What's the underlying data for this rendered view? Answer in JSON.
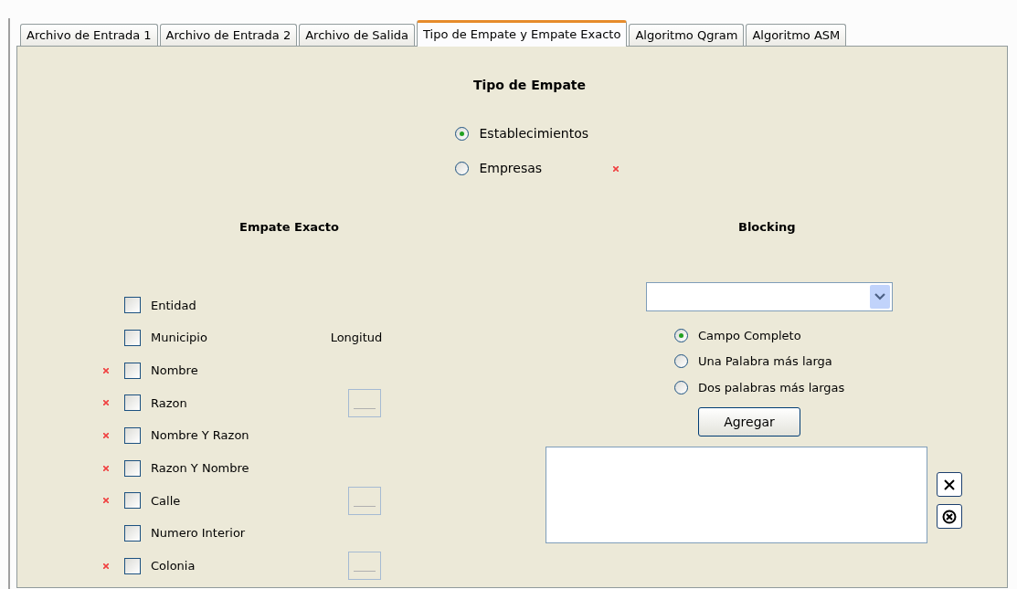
{
  "tabs": [
    {
      "label": "Archivo de Entrada 1",
      "selected": false
    },
    {
      "label": "Archivo de Entrada 2",
      "selected": false
    },
    {
      "label": "Archivo de Salida",
      "selected": false
    },
    {
      "label": "Tipo de Empate y Empate Exacto",
      "selected": true
    },
    {
      "label": "Algoritmo Qgram",
      "selected": false
    },
    {
      "label": "Algoritmo ASM",
      "selected": false
    }
  ],
  "tipo_empate": {
    "title": "Tipo de Empate",
    "options": [
      {
        "label": "Establecimientos",
        "selected": true,
        "error_marker": false
      },
      {
        "label": "Empresas",
        "selected": false,
        "error_marker": true
      }
    ]
  },
  "empate_exacto": {
    "title": "Empate Exacto",
    "length_heading": "Longitud",
    "fields": [
      {
        "label": "Entidad",
        "checked": false,
        "error_marker": false,
        "length_field": false
      },
      {
        "label": "Municipio",
        "checked": false,
        "error_marker": false,
        "length_field": false
      },
      {
        "label": "Nombre",
        "checked": false,
        "error_marker": true,
        "length_field": false
      },
      {
        "label": "Razon",
        "checked": false,
        "error_marker": true,
        "length_field": true
      },
      {
        "label": "Nombre Y Razon",
        "checked": false,
        "error_marker": true,
        "length_field": false
      },
      {
        "label": "Razon Y Nombre",
        "checked": false,
        "error_marker": true,
        "length_field": false
      },
      {
        "label": "Calle",
        "checked": false,
        "error_marker": true,
        "length_field": true
      },
      {
        "label": "Numero Interior",
        "checked": false,
        "error_marker": false,
        "length_field": false
      },
      {
        "label": "Colonia",
        "checked": false,
        "error_marker": true,
        "length_field": true
      }
    ]
  },
  "blocking": {
    "title": "Blocking",
    "options": [
      {
        "label": "Campo Completo",
        "selected": true
      },
      {
        "label": "Una Palabra más larga",
        "selected": false
      },
      {
        "label": "Dos palabras más largas",
        "selected": false
      }
    ],
    "add_button": "Agregar"
  }
}
